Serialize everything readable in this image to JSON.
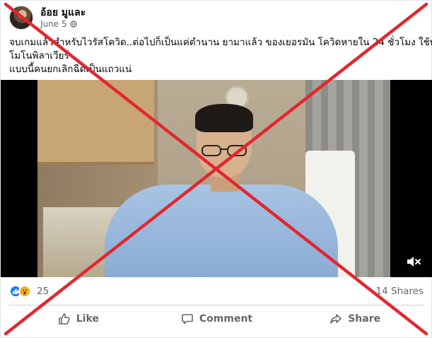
{
  "post": {
    "author": "อ้อย มูและ",
    "date": "June 5",
    "caption_lines": [
      "จบเกมแล้วสำหรับไวรัสโควิด..ต่อไปก็เป็นแค่ตำนาน ยามาแล้ว ของเยอรมัน โควิดหายใน 24 ชั่วโมง ใช้ทาน",
      "โมโนพิลาเวียร์",
      "แบบนี้คนยกเลิกฉีดเป็นแถวแน่"
    ]
  },
  "video": {
    "mute_icon": "speaker-muted-icon"
  },
  "stats": {
    "reactions": [
      "like",
      "wow"
    ],
    "reaction_count": "25",
    "shares": "14 Shares"
  },
  "actions": {
    "like": "Like",
    "comment": "Comment",
    "share": "Share"
  },
  "overlay": {
    "color": "#e3262e"
  },
  "colors": {
    "secondary_text": "#65676b",
    "like_blue": "#1877f2",
    "wow_yellow": "#f7b125"
  }
}
